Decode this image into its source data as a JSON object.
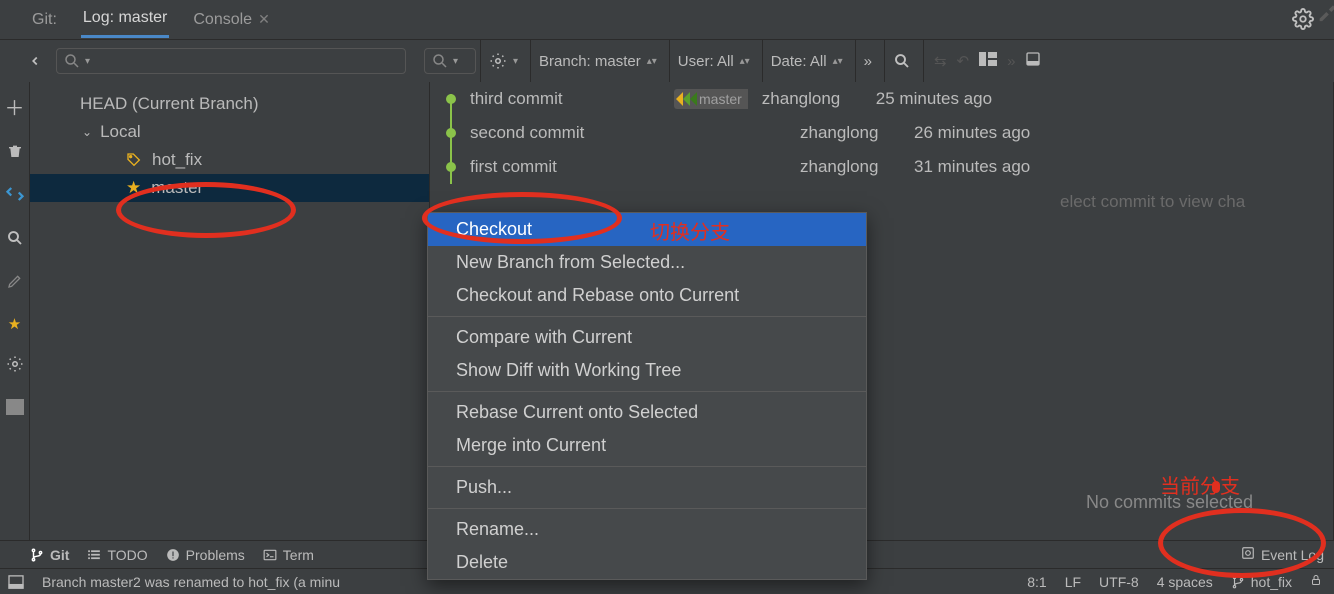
{
  "top_tabs": {
    "git_label": "Git:",
    "active_tab": "Log: master",
    "console_tab": "Console"
  },
  "filters": {
    "branch_label": "Branch:",
    "branch_value": "master",
    "user_label": "User:",
    "user_value": "All",
    "date_label": "Date:",
    "date_value": "All"
  },
  "tree": {
    "head_label": "HEAD (Current Branch)",
    "local_label": "Local",
    "branches": [
      {
        "name": "hot_fix",
        "icon": "tag"
      },
      {
        "name": "master",
        "icon": "star"
      }
    ]
  },
  "commits": [
    {
      "message": "third commit",
      "tag": "master",
      "author": "zhanglong",
      "when": "25 minutes ago"
    },
    {
      "message": "second commit",
      "tag": null,
      "author": "zhanglong",
      "when": "26 minutes ago"
    },
    {
      "message": "first commit",
      "tag": null,
      "author": "zhanglong",
      "when": "31 minutes ago"
    }
  ],
  "detail": {
    "select_hint": "elect commit to view cha",
    "no_commits": "No commits selected"
  },
  "context_menu": {
    "items": [
      {
        "label": "Checkout",
        "highlight": true
      },
      {
        "label": "New Branch from Selected..."
      },
      {
        "label": "Checkout and Rebase onto Current"
      },
      {
        "sep": true
      },
      {
        "label": "Compare with Current"
      },
      {
        "label": "Show Diff with Working Tree"
      },
      {
        "sep": true
      },
      {
        "label": "Rebase Current onto Selected"
      },
      {
        "label": "Merge into Current"
      },
      {
        "sep": true
      },
      {
        "label": "Push..."
      },
      {
        "sep": true
      },
      {
        "label": "Rename..."
      },
      {
        "label": "Delete",
        "disabled": false
      }
    ]
  },
  "annotations": {
    "switch_branch_label": "切换分支",
    "current_branch_label": "当前分支"
  },
  "bottom_tabs": {
    "git": "Git",
    "todo": "TODO",
    "problems": "Problems",
    "terminal": "Term",
    "event_log": "Event Log"
  },
  "status": {
    "message": "Branch master2 was renamed to hot_fix (a minu",
    "position": "8:1",
    "line_sep": "LF",
    "encoding": "UTF-8",
    "indent": "4 spaces",
    "branch": "hot_fix"
  }
}
